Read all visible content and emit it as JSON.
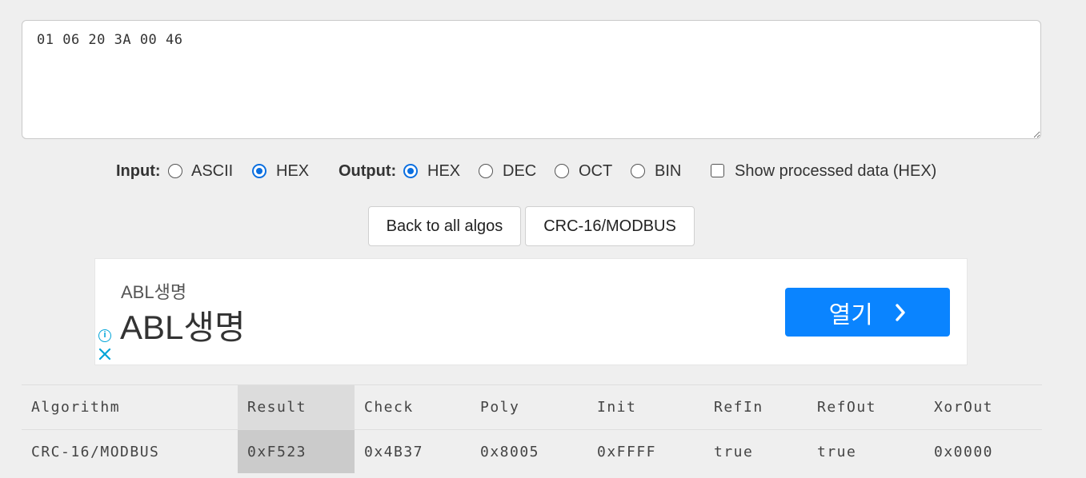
{
  "input": {
    "value": "01 06 20 3A 00 46"
  },
  "options": {
    "input_label": "Input:",
    "input_ascii": "ASCII",
    "input_hex": "HEX",
    "output_label": "Output:",
    "output_hex": "HEX",
    "output_dec": "DEC",
    "output_oct": "OCT",
    "output_bin": "BIN",
    "show_processed": "Show processed data (HEX)",
    "input_selected": "HEX",
    "output_selected": "HEX",
    "show_processed_checked": false
  },
  "buttons": {
    "back": "Back to all algos",
    "algo": "CRC-16/MODBUS"
  },
  "ad": {
    "subtitle": "ABL생명",
    "title": "ABL생명",
    "open_label": "열기",
    "accent_color": "#0a84ff",
    "info_icon": "info-icon",
    "close_icon": "close-icon"
  },
  "table": {
    "headers": [
      "Algorithm",
      "Result",
      "Check",
      "Poly",
      "Init",
      "RefIn",
      "RefOut",
      "XorOut"
    ],
    "rows": [
      [
        "CRC-16/MODBUS",
        "0xF523",
        "0x4B37",
        "0x8005",
        "0xFFFF",
        "true",
        "true",
        "0x0000"
      ]
    ]
  }
}
